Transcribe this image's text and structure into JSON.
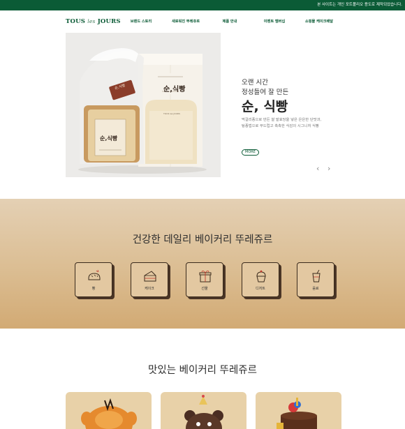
{
  "notice": "본 사이트는 개인 포트폴리오 용도로 제작되었습니다.",
  "logo": {
    "main1": "TOUS ",
    "les": "les",
    "main2": " JOURS"
  },
  "nav": [
    "브랜드 스토리",
    "새로워진 뚜레쥬르",
    "제품 안내",
    "이벤트 멤버십",
    "쇼핑몰 케이크배달"
  ],
  "hero": {
    "subtitle1": "오랜 시간",
    "subtitle2": "정성들여 잘 만든",
    "title": "순, 식빵",
    "desc1": "먹걸리종으로 만든 쌀 발효당을 넣은 은은한 단맛과,",
    "desc2": "탕종법으로 부드럽고 촉촉한 식감의 시그니처 식빵",
    "more": "MORE",
    "prev": "‹",
    "next": "›",
    "bag_label": "순,식빵",
    "bag_tag": "순,식빵",
    "bag_sub": "TOUS les JOURS"
  },
  "categories": {
    "title": "건강한 데일리 베이커리 뚜레쥬르",
    "items": [
      {
        "label": "빵",
        "icon": "bread-icon"
      },
      {
        "label": "케이크",
        "icon": "cake-slice-icon"
      },
      {
        "label": "선물",
        "icon": "gift-box-icon"
      },
      {
        "label": "디저트",
        "icon": "cupcake-icon"
      },
      {
        "label": "음료",
        "icon": "drink-cup-icon"
      }
    ]
  },
  "products": {
    "title": "맛있는 베이커리 뚜레쥬르"
  },
  "colors": {
    "brand_green": "#0b5b36",
    "section_tan": "#dbbd92",
    "card_outline": "#3a2a1c"
  }
}
